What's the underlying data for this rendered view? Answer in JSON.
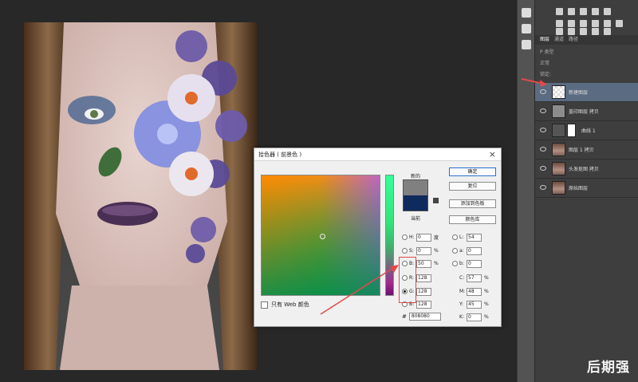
{
  "dialog": {
    "title": "拾色器 ( 前景色 )",
    "close_glyph": "×",
    "new_label": "新的",
    "current_label": "当前",
    "buttons": {
      "ok": "确定",
      "reset": "复位",
      "add_to_swatches": "添加到色板",
      "color_libraries": "颜色库"
    },
    "hsb": [
      {
        "label": "H:",
        "value": "0",
        "unit": "度"
      },
      {
        "label": "S:",
        "value": "0",
        "unit": "%"
      },
      {
        "label": "B:",
        "value": "50",
        "unit": "%"
      }
    ],
    "rgb": [
      {
        "label": "R:",
        "value": "128"
      },
      {
        "label": "G:",
        "value": "128"
      },
      {
        "label": "B:",
        "value": "128"
      }
    ],
    "lab": [
      {
        "label": "L:",
        "value": "54"
      },
      {
        "label": "a:",
        "value": "0"
      },
      {
        "label": "b:",
        "value": "0"
      }
    ],
    "cmyk": [
      {
        "label": "C:",
        "value": "57",
        "unit": "%"
      },
      {
        "label": "M:",
        "value": "48",
        "unit": "%"
      },
      {
        "label": "Y:",
        "value": "45",
        "unit": "%"
      },
      {
        "label": "K:",
        "value": "0",
        "unit": "%"
      }
    ],
    "hex_label": "#",
    "hex_value": "808080",
    "web_only_label": "只有 Web 颜色",
    "new_color": "#808080",
    "current_color": "#0f2a5c"
  },
  "layers_panel": {
    "tabs": [
      "图层",
      "通道",
      "路径"
    ],
    "kind_label": "P 类型",
    "blend_mode": "正常",
    "lock_label": "锁定:",
    "layers": [
      {
        "name": "新建图层",
        "selected": true
      },
      {
        "name": "盖印图层 拷贝",
        "selected": false
      },
      {
        "name": "曲线 1",
        "selected": false
      },
      {
        "name": "图层 1 拷贝",
        "selected": false
      },
      {
        "name": "头发抠图 拷贝",
        "selected": false
      },
      {
        "name": "原始图层",
        "selected": false
      }
    ]
  },
  "watermark": "后期强",
  "colors": {
    "highlight": "#e04a4a",
    "selected_layer": "#5a6b82"
  }
}
